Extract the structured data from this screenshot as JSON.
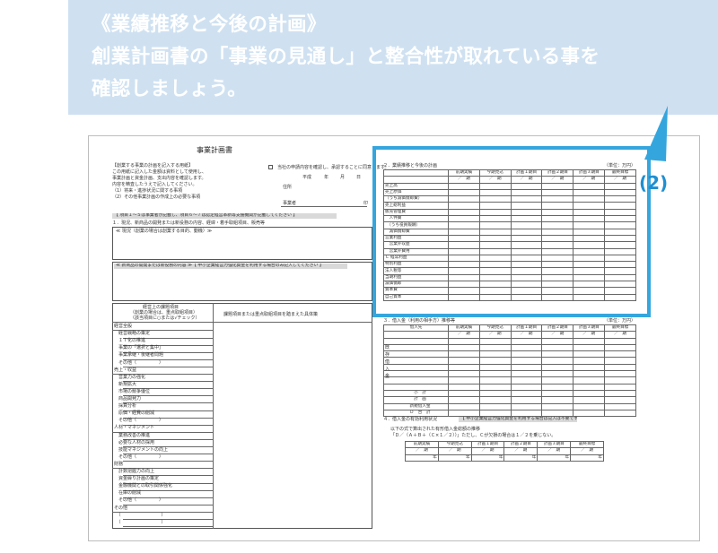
{
  "banner": {
    "line1": "《業績推移と今後の計画》",
    "line2": "創業計画書の「事業の見通し」と整合性が取れている事を",
    "line3": "確認しましょう。"
  },
  "callout": {
    "label": "(2)",
    "color": "#35a6dd"
  },
  "document": {
    "title": "事業計画書",
    "intro": [
      "【創業する事業の計画を記入する用紙】",
      "この用紙に記入した金額は資料として使用し、",
      "事業計画と資金計画、支出内容を確認します。",
      "内容を精査したうえで記入してください。",
      "（1）将来・進捗状況に関する事項",
      "（2）その他事業計画の作成上の必要な事項"
    ],
    "confirm_text": "当社の申請内容を確認し、承認することに同意します。",
    "date_labels": [
      "平成",
      "年",
      "月",
      "日"
    ],
    "address_label": "住所",
    "applicant_label": "事業者",
    "seal_label": "印",
    "section1_heading": "【 項目１〜５は事業者が記載し、項目６〜７は認定経営革新等支援機関が記載してください 】",
    "section1_title": "１．現況、新商品の開発または新役務の内容、経緯・着手取組項目、販売等",
    "section1_sub": "≪ 現況（創業の場合は創業する目的、動機）≫",
    "section1_sub2": "≪ 新商品の開発または新役務の内容 ≫【 中小企業経営力強化資金を利用する場合のみ記入してください 】",
    "mgmt_col_title": "経営上の課題項目",
    "mgmt_col_sub1": "（創業の場合は、重点取組項目）",
    "mgmt_col_sub2": "（該当項目に○または√チェック）",
    "mgmt_col_right": "課題項目または重点取組項目を踏まえた具体策",
    "mgmt_items": [
      "経営全般",
      "　経営戦略の策定",
      "　ＩＴ化の推進",
      "　事業の「選択と集中」",
      "　事業承継・後継者問題",
      "　その他（　　　　　）",
      "売上・収益",
      "　営業力の強化",
      "　新規拡大",
      "　市場の競争優位",
      "　商品開発力",
      "　採算分析",
      "　原価・経費の削減",
      "　その他（　　　　　）",
      "人材・マネジメント",
      "　業務改善の推進",
      "　必要な人材の採用",
      "　技能マネジメントの向上",
      "　その他（　　　　　）",
      "財務",
      "　計数把握力の向上",
      "　資金繰り計画の策定",
      "　金融機関との取引関係強化",
      "　在庫の削減",
      "　その他（　　　　　）",
      "その他",
      "　（　　　　　　　　　）",
      "　（　　　　　　　　　）"
    ],
    "section2_title": "２．業績推移と今後の計画",
    "unit_label": "（単位：万円）",
    "col_headers": [
      "前期実績",
      "今期見込",
      "計画１期目",
      "計画２期目",
      "計画３期目",
      "最終目標"
    ],
    "period_cell": "／　期",
    "section2_rows": [
      "売上高",
      "売上原価",
      "（うち減価償却費）",
      "売上総利益",
      "販売管理費",
      "　人件費",
      "　（うち役員報酬）",
      "　減価償却費",
      "営業利益",
      "　営業外収益",
      "　営業外費用",
      "Ｃ 経常利益",
      "特別利益",
      "法人税等",
      "当期利益",
      "減価償却",
      "資本費",
      "自己資本"
    ],
    "section3_title": "３．借入金（利用の相手方）推移等",
    "section3_row_label": "借入先",
    "section3_side_label": "既存借入金",
    "section3_rows": [
      "",
      "",
      "",
      "",
      "",
      "",
      "",
      "",
      "小　計",
      "計　画",
      "新規借入金",
      "Ｄ　合　計"
    ],
    "section4_title": "４．借入金の有効利用状況",
    "section4_note": "【 中小企業経営力強化資金を利用する場合は記入は不要です 】",
    "section4_desc": "以下の式で算出された有形借入金総額の推移",
    "section4_formula": "「Ｄ／（Ａ＋Ｂ＋（Ｃ×１／２））」ただし、Ｃが欠損の場合は１／２を乗じない。",
    "section4_cell": "年"
  }
}
